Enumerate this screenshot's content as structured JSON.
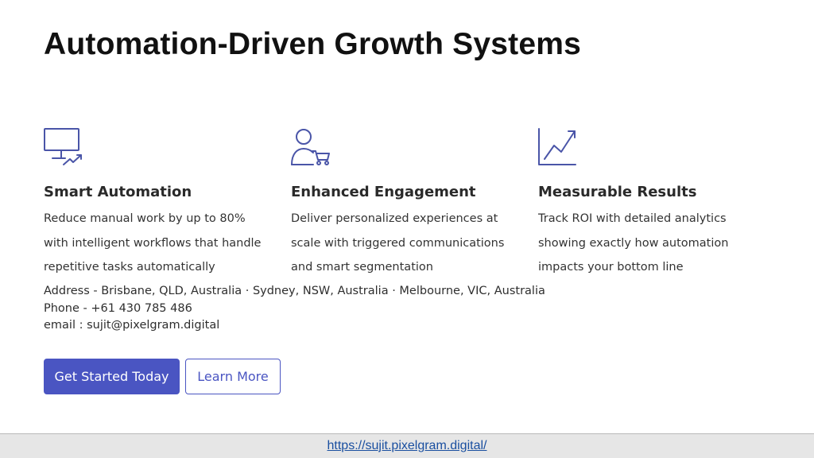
{
  "page": {
    "title": "Automation-Driven Growth Systems"
  },
  "colors": {
    "accent": "#4a55c2",
    "icon": "#4a55a8",
    "footer_bg": "#e6e6e6",
    "link": "#1a4fa0"
  },
  "features": [
    {
      "icon": "monitor-trend-icon",
      "title": "Smart Automation",
      "lines": [
        "Reduce manual work by up to 80%",
        "with intelligent workflows that handle",
        "repetitive tasks automatically"
      ]
    },
    {
      "icon": "user-cart-icon",
      "title": "Enhanced Engagement",
      "lines": [
        "Deliver personalized experiences at",
        "scale with triggered communications",
        "and smart segmentation"
      ]
    },
    {
      "icon": "growth-chart-icon",
      "title": "Measurable Results",
      "lines": [
        "Track ROI with detailed analytics",
        "showing exactly how automation",
        "impacts your bottom line"
      ]
    }
  ],
  "contact": {
    "address": "Address - Brisbane, QLD, Australia · Sydney, NSW, Australia · Melbourne, VIC, Australia",
    "phone": "Phone - +61 430 785 486",
    "email": "email : sujit@pixelgram.digital"
  },
  "buttons": {
    "primary": "Get Started Today",
    "secondary": "Learn More"
  },
  "footer": {
    "url": "https://sujit.pixelgram.digital/"
  }
}
